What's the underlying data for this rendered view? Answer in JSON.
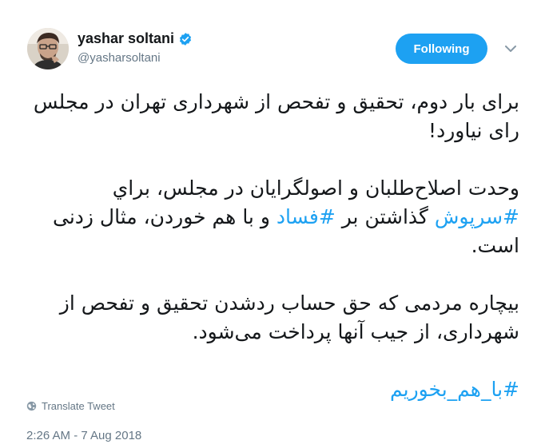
{
  "user": {
    "display_name": "yashar soltani",
    "handle": "@yasharsoltani",
    "verified": true
  },
  "follow_button": {
    "label": "Following"
  },
  "tweet": {
    "paragraph1": "برای بار دوم، تحقیق و تفحص از شهرداری تهران در مجلس رای نیاورد!",
    "paragraph2_before": "وحدت اصلاح‌طلبان و اصولگرایان در مجلس، براي ",
    "hashtag1": "#سرپوش",
    "paragraph2_mid": " گذاشتن بر ",
    "hashtag2": "#فساد",
    "paragraph2_after": " و با هم خوردن، مثال زدنی است.",
    "paragraph3": "بیچاره مردمی که حق حساب ردشدن تحقیق و تفحص از شهرداری، از جیب آنها پرداخت می‌شود.",
    "hashtag3": "#با_هم_بخوریم"
  },
  "translate": {
    "label": "Translate Tweet",
    "icon": "globe-icon"
  },
  "timestamp": "2:26 AM - 7 Aug 2018",
  "colors": {
    "accent": "#1da1f2",
    "secondary_text": "#657786",
    "primary_text": "#14171a"
  }
}
